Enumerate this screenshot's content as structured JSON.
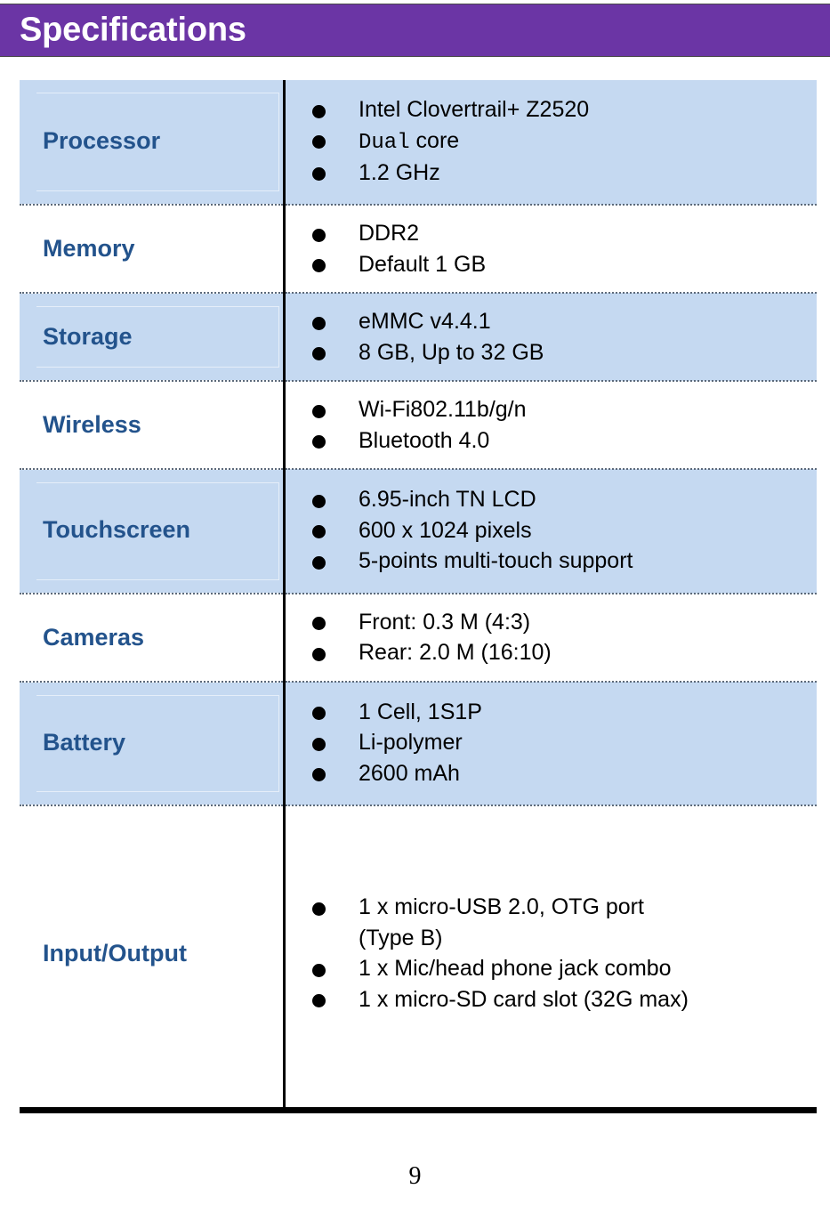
{
  "header": {
    "title": "Specifications",
    "background_color": "#6B35A5",
    "text_color": "#FFFFFF"
  },
  "table": {
    "label_color": "#23538C",
    "shaded_row_color": "#C5D9F1",
    "plain_row_color": "#FFFFFF",
    "bullet_icon": "filled-circle-bullet",
    "rows": [
      {
        "label": "Processor",
        "shaded": true,
        "items": [
          {
            "text": "Intel Clovertrail+ Z2520"
          },
          {
            "mono_prefix": "Dual",
            "text": " core"
          },
          {
            "text": "1.2 GHz"
          }
        ]
      },
      {
        "label": "Memory",
        "shaded": false,
        "items": [
          {
            "text": "DDR2"
          },
          {
            "text": "Default 1 GB"
          }
        ]
      },
      {
        "label": "Storage",
        "shaded": true,
        "items": [
          {
            "text": "eMMC v4.4.1"
          },
          {
            "text": "8 GB, Up to 32 GB"
          }
        ]
      },
      {
        "label": "Wireless",
        "shaded": false,
        "items": [
          {
            "text": "Wi-Fi802.11b/g/n"
          },
          {
            "text": "Bluetooth 4.0"
          }
        ]
      },
      {
        "label": "Touchscreen",
        "shaded": true,
        "items": [
          {
            "text": "6.95-inch TN LCD"
          },
          {
            "text": "600 x 1024 pixels"
          },
          {
            "text": "5-points multi-touch support"
          }
        ]
      },
      {
        "label": "Cameras",
        "shaded": false,
        "items": [
          {
            "text": "Front: 0.3 M (4:3)"
          },
          {
            "text": "Rear: 2.0 M (16:10)"
          }
        ]
      },
      {
        "label": "Battery",
        "shaded": true,
        "items": [
          {
            "text": "1 Cell, 1S1P"
          },
          {
            "text": "Li-polymer"
          },
          {
            "text": "2600 mAh"
          }
        ]
      },
      {
        "label": "Input/Output",
        "shaded": false,
        "items": [
          {
            "text": "1 x micro-USB 2.0, OTG port",
            "second_line": "(Type B)"
          },
          {
            "text": "1 x Mic/head phone jack combo"
          },
          {
            "text": "1 x micro-SD card slot (32G max)"
          }
        ]
      }
    ]
  },
  "footer": {
    "page_number": "9"
  }
}
